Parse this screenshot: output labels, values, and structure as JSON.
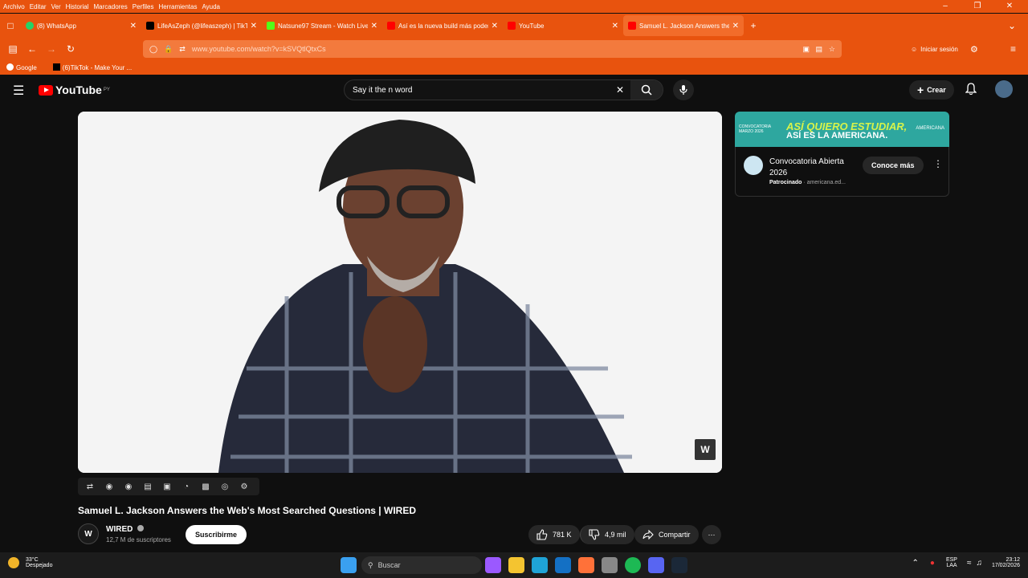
{
  "menubar": {
    "items": [
      "Archivo",
      "Editar",
      "Ver",
      "Historial",
      "Marcadores",
      "Perfiles",
      "Herramientas",
      "Ayuda"
    ]
  },
  "tabs": [
    {
      "label": "(8) WhatsApp",
      "color": "#25d366"
    },
    {
      "label": "LifeAsZeph (@lifeaszeph) | TikTok",
      "color": "#000000"
    },
    {
      "label": "Natsune97 Stream - Watch Live",
      "color": "#53fc18"
    },
    {
      "label": "Así es la nueva build más poderosa",
      "color": "#ff0000"
    },
    {
      "label": "YouTube",
      "color": "#ff0000"
    },
    {
      "label": "Samuel L. Jackson Answers the Web",
      "color": "#ff0000"
    }
  ],
  "navbar": {
    "url": "www.youtube.com/watch?v=kSVQtlQtxCs",
    "signin": "Iniciar sesión"
  },
  "bookmarks": [
    "Google",
    "(6)TikTok - Make Your ..."
  ],
  "youtube": {
    "logo": "YouTube",
    "region": "PY",
    "search_value": "Say it the n word",
    "create": "Crear"
  },
  "video": {
    "title": "Samuel L. Jackson Answers the Web's Most Searched Questions | WIRED",
    "watermark": "W",
    "channel": "WIRED",
    "channel_initial": "W",
    "subscribers": "12,7 M de suscriptores",
    "subscribe": "Suscribirme",
    "likes": "781 K",
    "dislikes": "4,9 mil",
    "share": "Compartir"
  },
  "ad": {
    "banner_small": "CONVOCATORIA MARZO 2026",
    "banner_line1": "ASÍ QUIERO ESTUDIAR,",
    "banner_line2": "ASÍ ES LA AMERICANA.",
    "banner_brand": "AMERICANA",
    "title": "Convocatoria Abierta 2026",
    "sponsored": "Patrocinado",
    "domain": "americana.ed...",
    "cta": "Conoce más"
  },
  "taskbar": {
    "temp": "33°C",
    "weather": "Despejado",
    "search": "Buscar",
    "lang1": "ESP",
    "lang2": "LAA",
    "time": "23:12",
    "date": "17/02/2026"
  }
}
